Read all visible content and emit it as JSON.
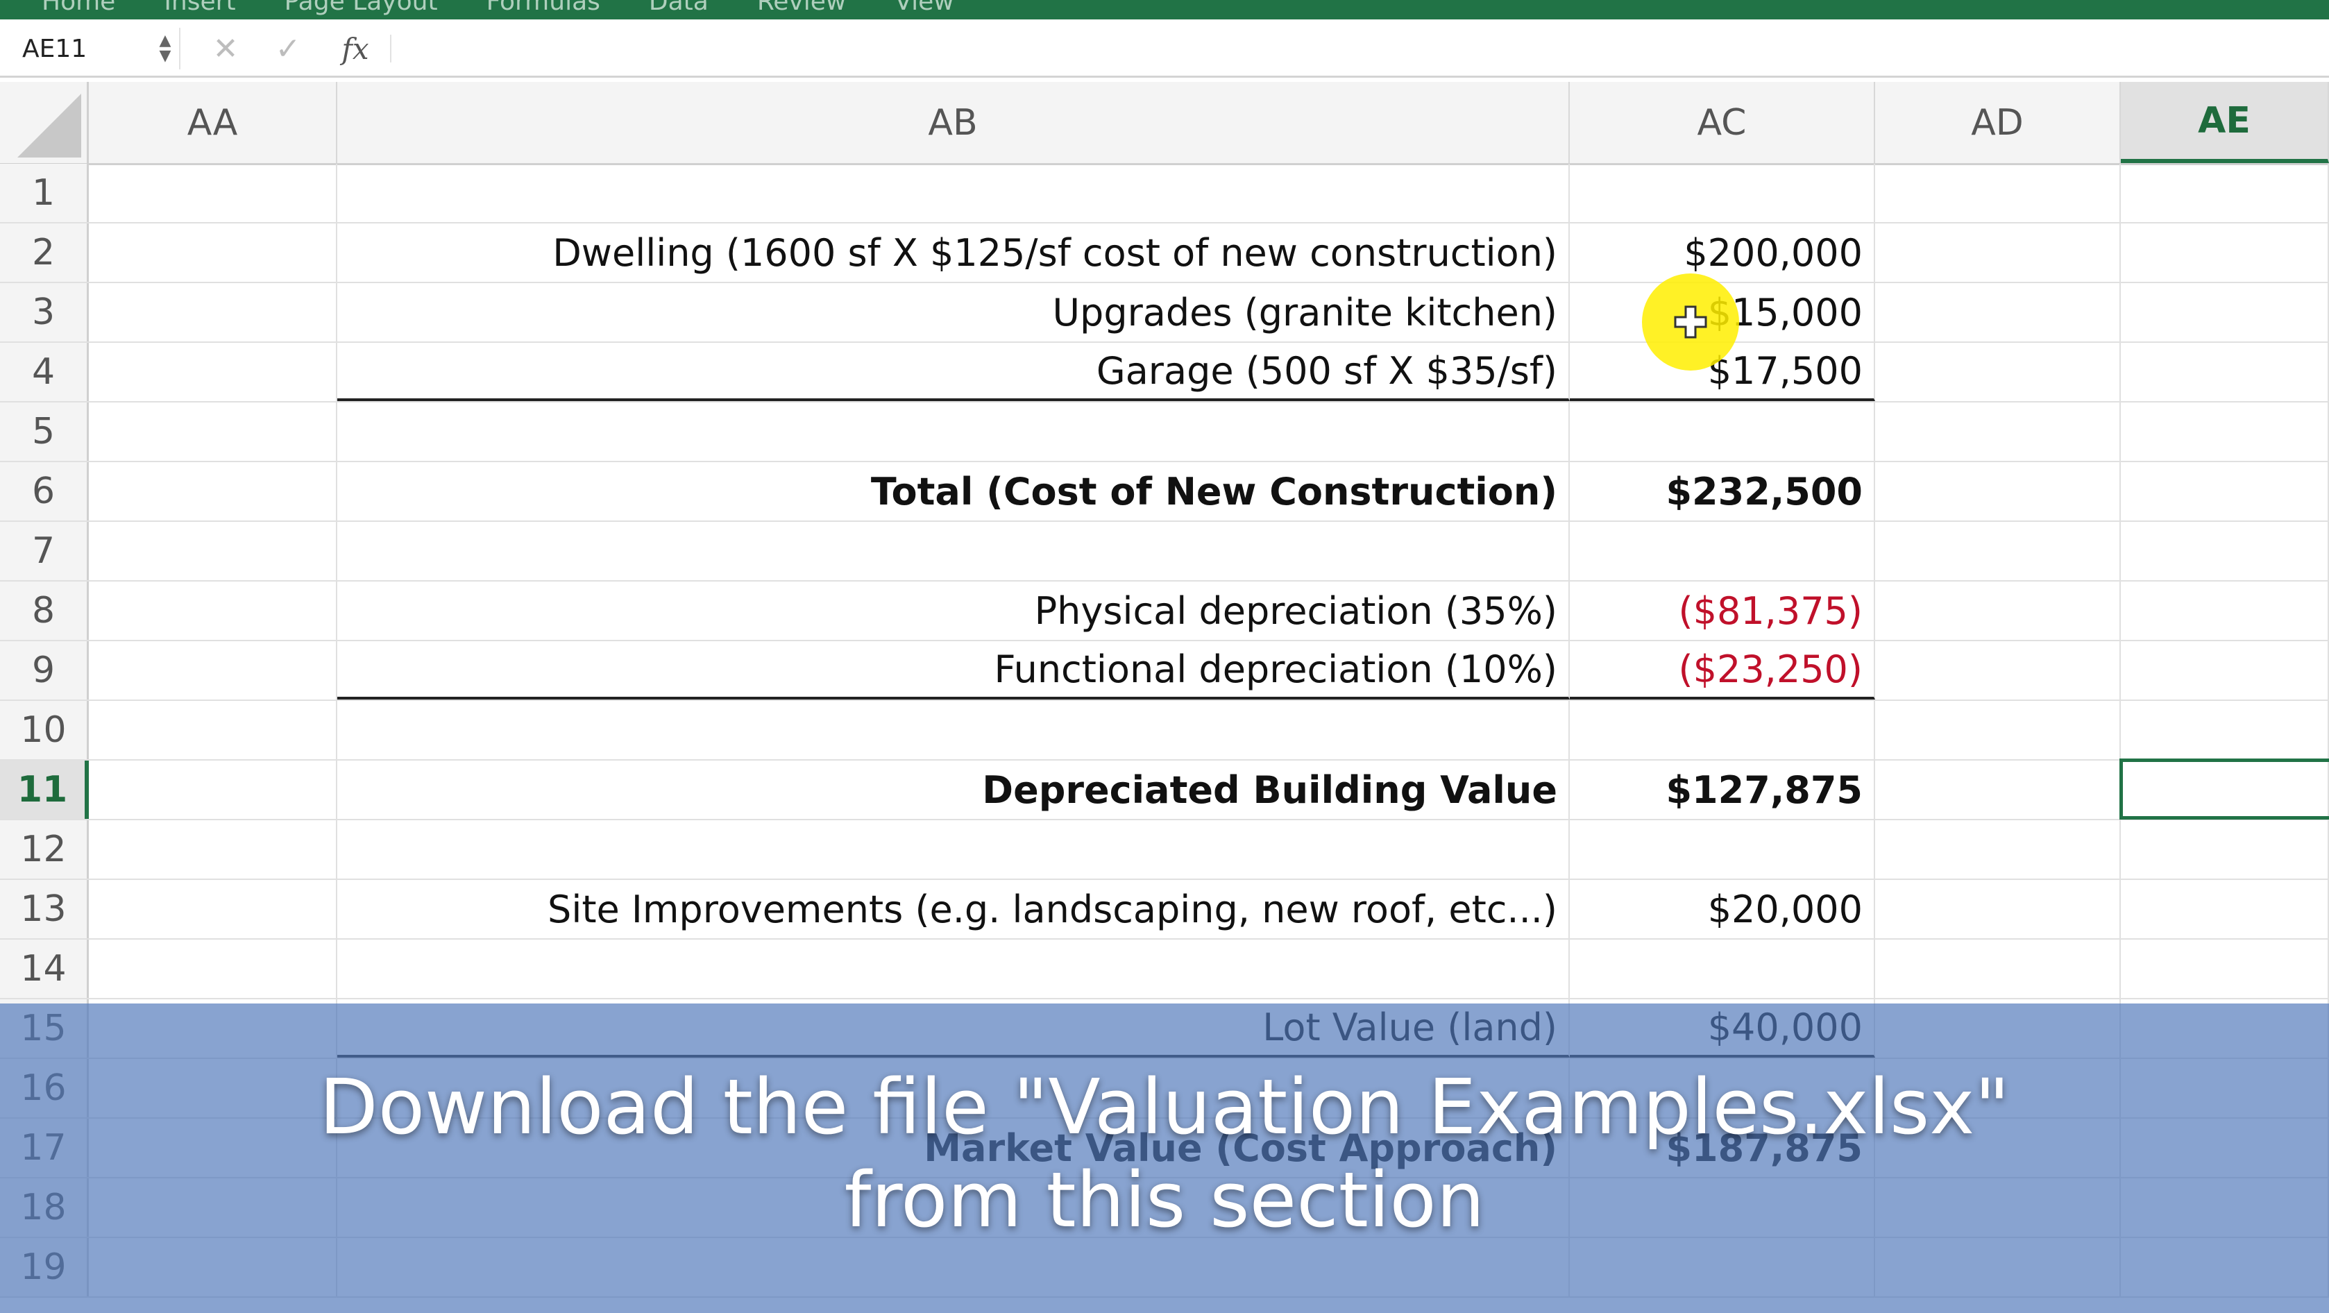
{
  "ribbon": {
    "tabs": [
      "Home",
      "Insert",
      "Page Layout",
      "Formulas",
      "Data",
      "Review",
      "View"
    ]
  },
  "formula_bar": {
    "name_box": "AE11",
    "cancel_icon": "✕",
    "enter_icon": "✓",
    "fx_label": "fx",
    "formula": ""
  },
  "columns": [
    {
      "label": "AA"
    },
    {
      "label": "AB"
    },
    {
      "label": "AC"
    },
    {
      "label": "AD"
    },
    {
      "label": "AE",
      "selected": true
    }
  ],
  "rows": [
    {
      "num": "1",
      "ab": "",
      "ac": ""
    },
    {
      "num": "2",
      "ab": "Dwelling (1600 sf X $125/sf cost of new construction)",
      "ac": "$200,000"
    },
    {
      "num": "3",
      "ab": "Upgrades (granite kitchen)",
      "ac": "$15,000"
    },
    {
      "num": "4",
      "ab": "Garage (500 sf X $35/sf)",
      "ac": "$17,500",
      "underline": true
    },
    {
      "num": "5",
      "ab": "",
      "ac": ""
    },
    {
      "num": "6",
      "ab": "Total (Cost of New Construction)",
      "ac": "$232,500",
      "bold": true
    },
    {
      "num": "7",
      "ab": "",
      "ac": ""
    },
    {
      "num": "8",
      "ab": "Physical depreciation (35%)",
      "ac": "($81,375)",
      "negative": true
    },
    {
      "num": "9",
      "ab": "Functional depreciation (10%)",
      "ac": "($23,250)",
      "negative": true,
      "underline": true
    },
    {
      "num": "10",
      "ab": "",
      "ac": ""
    },
    {
      "num": "11",
      "ab": "Depreciated Building Value",
      "ac": "$127,875",
      "bold": true,
      "selected": true
    },
    {
      "num": "12",
      "ab": "",
      "ac": ""
    },
    {
      "num": "13",
      "ab": "Site Improvements (e.g. landscaping, new roof, etc...)",
      "ac": "$20,000"
    },
    {
      "num": "14",
      "ab": "",
      "ac": ""
    },
    {
      "num": "15",
      "ab": "Lot Value (land)",
      "ac": "$40,000",
      "underline": true
    },
    {
      "num": "16",
      "ab": "",
      "ac": ""
    },
    {
      "num": "17",
      "ab": "Market Value (Cost Approach)",
      "ac": "$187,875",
      "bold": true
    },
    {
      "num": "18",
      "ab": "",
      "ac": ""
    },
    {
      "num": "19",
      "ab": "",
      "ac": ""
    }
  ],
  "active_cell": "AE11",
  "overlay": {
    "line1": "Download the file \"Valuation Examples.xlsx\"",
    "line2": "from this section"
  },
  "colors": {
    "excel_green": "#217346",
    "negative_red": "#c0102a",
    "banner_blue": "#5078b9",
    "cursor_yellow": "#ffee00"
  }
}
